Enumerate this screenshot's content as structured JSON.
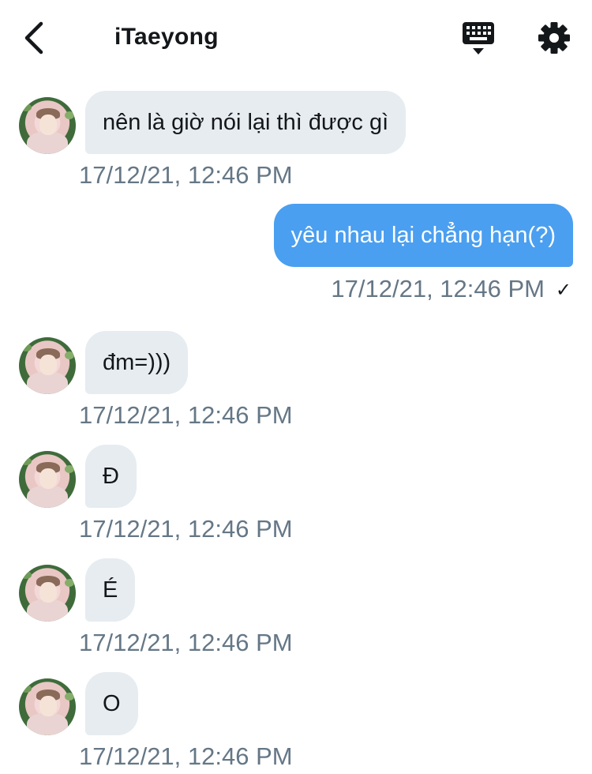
{
  "header": {
    "title": "iTaeyong",
    "icons": {
      "back": "chevron-left-icon",
      "keyboard": "keyboard-icon",
      "settings": "gear-icon"
    }
  },
  "messages": [
    {
      "side": "in",
      "text": "nên là giờ nói lại thì được gì",
      "time": "17/12/21, 12:46 PM"
    },
    {
      "side": "out",
      "text": "yêu nhau lại chẳng hạn(?)",
      "time": "17/12/21, 12:46 PM",
      "status": "✓"
    },
    {
      "side": "in",
      "text": "đm=)))",
      "time": "17/12/21, 12:46 PM"
    },
    {
      "side": "in",
      "text": "Đ",
      "time": "17/12/21, 12:46 PM"
    },
    {
      "side": "in",
      "text": "É",
      "time": "17/12/21, 12:46 PM"
    },
    {
      "side": "in",
      "text": "O",
      "time": "17/12/21, 12:46 PM"
    }
  ],
  "colors": {
    "incoming_bubble": "#e6ecf0",
    "outgoing_bubble": "#4a9ff0",
    "timestamp": "#657786"
  }
}
